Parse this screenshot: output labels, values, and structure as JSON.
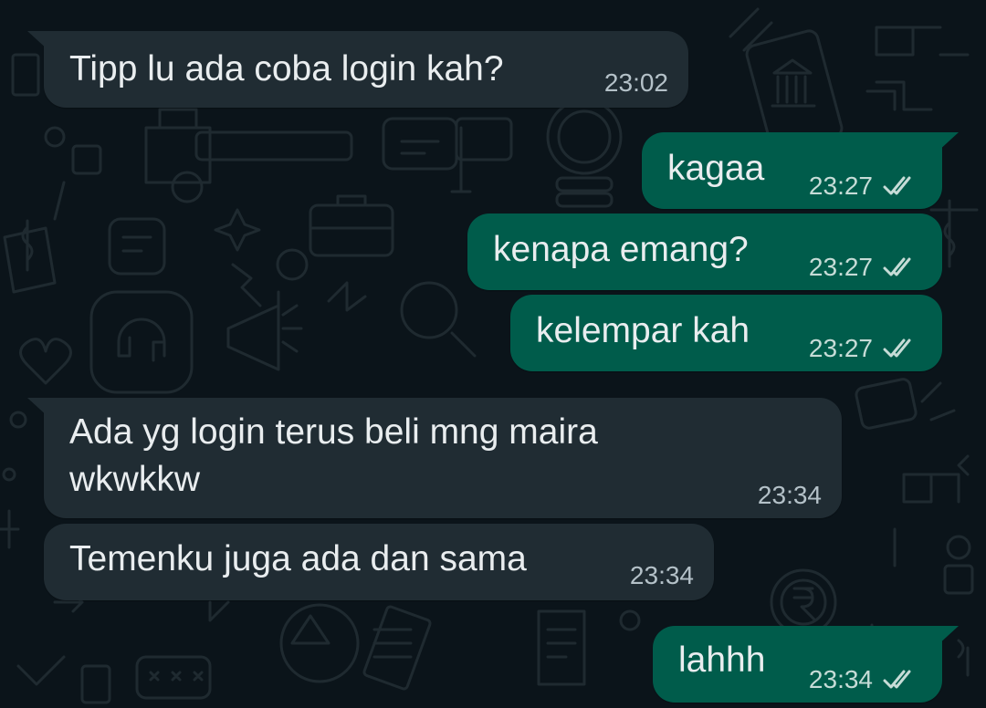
{
  "colors": {
    "background": "#0b141a",
    "incoming_bubble": "#202c33",
    "outgoing_bubble": "#005c4b",
    "text": "#e9edef",
    "doodle": "#1f2a30"
  },
  "messages": [
    {
      "direction": "incoming",
      "text": "Tipp lu ada coba login kah?",
      "time": "23:02"
    },
    {
      "direction": "outgoing",
      "text": "kagaa",
      "time": "23:27",
      "status_icon": "double-check-icon"
    },
    {
      "direction": "outgoing",
      "text": "kenapa emang?",
      "time": "23:27",
      "status_icon": "double-check-icon"
    },
    {
      "direction": "outgoing",
      "text": "kelempar kah",
      "time": "23:27",
      "status_icon": "double-check-icon"
    },
    {
      "direction": "incoming",
      "text": "Ada yg login terus beli mng maira wkwkkw",
      "time": "23:34"
    },
    {
      "direction": "incoming",
      "text": "Temenku juga ada dan sama",
      "time": "23:34"
    },
    {
      "direction": "outgoing",
      "text": "lahhh",
      "time": "23:34",
      "status_icon": "double-check-icon"
    }
  ]
}
